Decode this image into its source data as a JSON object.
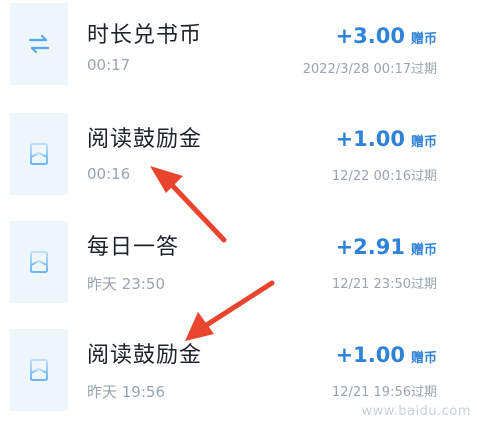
{
  "transactions": [
    {
      "icon": "exchange-arrows-icon",
      "title": "时长兑书币",
      "time": "00:17",
      "amount": "+3.00",
      "unit": "赠币",
      "expire": "2022/3/28 00:17过期"
    },
    {
      "icon": "book-icon",
      "title": "阅读鼓励金",
      "time": "00:16",
      "amount": "+1.00",
      "unit": "赠币",
      "expire": "12/22 00:16过期"
    },
    {
      "icon": "book-icon",
      "title": "每日一答",
      "time": "昨天 23:50",
      "amount": "+2.91",
      "unit": "赠币",
      "expire": "12/21 23:50过期"
    },
    {
      "icon": "book-icon",
      "title": "阅读鼓励金",
      "time": "昨天 19:56",
      "amount": "+1.00",
      "unit": "赠币",
      "expire": "12/21 19:56过期"
    }
  ],
  "colors": {
    "accent": "#2f82d7",
    "arrow": "#e8442e",
    "icon_bg": "#eef5fb"
  },
  "watermark": "www.baidu.com"
}
